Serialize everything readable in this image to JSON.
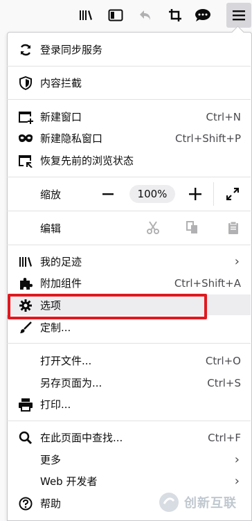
{
  "toolbar": {
    "icons": [
      "library-icon",
      "sidebar-icon",
      "undo-icon",
      "screenshot-icon",
      "chat-icon",
      "hamburger-menu-icon"
    ]
  },
  "menu": {
    "sync": {
      "label": "登录同步服务"
    },
    "content_blocking": {
      "label": "内容拦截"
    },
    "new_window": {
      "label": "新建窗口",
      "shortcut": "Ctrl+N"
    },
    "new_private_window": {
      "label": "新建隐私窗口",
      "shortcut": "Ctrl+Shift+P"
    },
    "restore_session": {
      "label": "恢复先前的浏览状态"
    },
    "zoom": {
      "label": "缩放",
      "minus": "—",
      "value": "100%",
      "plus": "+",
      "fullscreen": "⤢"
    },
    "edit": {
      "label": "编辑"
    },
    "library": {
      "label": "我的足迹",
      "arrow": "›"
    },
    "addons": {
      "label": "附加组件",
      "shortcut": "Ctrl+Shift+A"
    },
    "options": {
      "label": "选项"
    },
    "customize": {
      "label": "定制..."
    },
    "open_file": {
      "label": "打开文件...",
      "shortcut": "Ctrl+O"
    },
    "save_page": {
      "label": "另存页面为...",
      "shortcut": "Ctrl+S"
    },
    "print": {
      "label": "打印..."
    },
    "find": {
      "label": "在此页面中查找...",
      "shortcut": "Ctrl+F"
    },
    "more": {
      "label": "更多",
      "arrow": "›"
    },
    "web_developer": {
      "label": "Web 开发者",
      "arrow": "›"
    },
    "help": {
      "label": "帮助"
    }
  },
  "watermark": {
    "text": "创新互联"
  },
  "colors": {
    "highlight": "#e0191f",
    "panel_bg": "#ffffff",
    "toolbar_bg": "#f9f9fa"
  }
}
